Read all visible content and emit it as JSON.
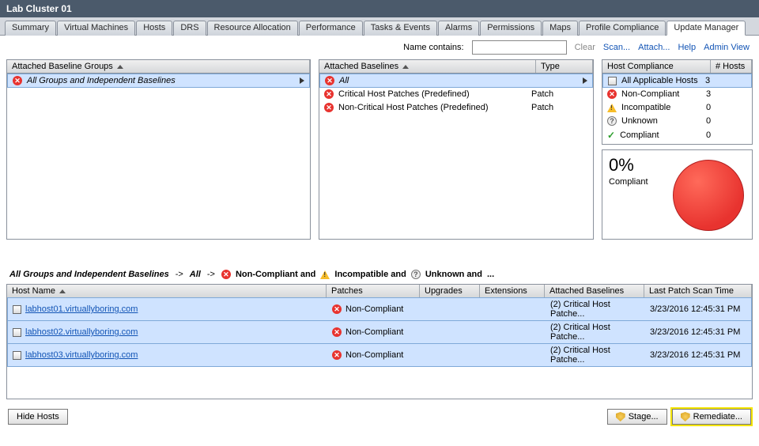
{
  "title": "Lab Cluster 01",
  "tabs": [
    "Summary",
    "Virtual Machines",
    "Hosts",
    "DRS",
    "Resource Allocation",
    "Performance",
    "Tasks & Events",
    "Alarms",
    "Permissions",
    "Maps",
    "Profile Compliance",
    "Update Manager"
  ],
  "active_tab": "Update Manager",
  "toolbar": {
    "name_contains": "Name contains:",
    "clear": "Clear",
    "scan": "Scan...",
    "attach": "Attach...",
    "help": "Help",
    "admin": "Admin View"
  },
  "baseline_groups": {
    "header": "Attached Baseline Groups",
    "row": "All Groups and Independent Baselines"
  },
  "baselines": {
    "header_name": "Attached Baselines",
    "header_type": "Type",
    "rows": [
      {
        "name": "All",
        "type": "",
        "sel": true,
        "icon": "err",
        "italic": true
      },
      {
        "name": "Critical Host Patches (Predefined)",
        "type": "Patch",
        "icon": "err"
      },
      {
        "name": "Non-Critical Host Patches (Predefined)",
        "type": "Patch",
        "icon": "err"
      }
    ]
  },
  "compliance": {
    "header_name": "Host Compliance",
    "header_count": "# Hosts",
    "rows": [
      {
        "icon": "host",
        "label": "All Applicable Hosts",
        "count": 3,
        "sel": true
      },
      {
        "icon": "err",
        "label": "Non-Compliant",
        "count": 3
      },
      {
        "icon": "warn",
        "label": "Incompatible",
        "count": 0
      },
      {
        "icon": "unk",
        "label": "Unknown",
        "count": 0
      },
      {
        "icon": "ok",
        "label": "Compliant",
        "count": 0
      }
    ],
    "percent": "0%",
    "percent_label": "Compliant"
  },
  "filter": {
    "p1": "All Groups and Independent Baselines",
    "a1": "->",
    "p2": "All",
    "a2": "->",
    "nc": "Non-Compliant and",
    "inc": "Incompatible and",
    "unk": "Unknown and",
    "dots": "..."
  },
  "hosts_table": {
    "headers": {
      "host": "Host Name",
      "pat": "Patches",
      "upg": "Upgrades",
      "ext": "Extensions",
      "ab": "Attached Baselines",
      "tm": "Last Patch Scan Time"
    },
    "rows": [
      {
        "host": "labhost01.virtuallyboring.com",
        "pat": "Non-Compliant",
        "upg": "",
        "ext": "",
        "ab": "(2) Critical Host Patche...",
        "tm": "3/23/2016 12:45:31 PM"
      },
      {
        "host": "labhost02.virtuallyboring.com",
        "pat": "Non-Compliant",
        "upg": "",
        "ext": "",
        "ab": "(2) Critical Host Patche...",
        "tm": "3/23/2016 12:45:31 PM"
      },
      {
        "host": "labhost03.virtuallyboring.com",
        "pat": "Non-Compliant",
        "upg": "",
        "ext": "",
        "ab": "(2) Critical Host Patche...",
        "tm": "3/23/2016 12:45:31 PM"
      }
    ]
  },
  "buttons": {
    "hide": "Hide Hosts",
    "stage": "Stage...",
    "remediate": "Remediate..."
  },
  "chart_data": {
    "type": "pie",
    "title": "Host Compliance",
    "series": [
      {
        "name": "Non-Compliant",
        "value": 3
      },
      {
        "name": "Incompatible",
        "value": 0
      },
      {
        "name": "Unknown",
        "value": 0
      },
      {
        "name": "Compliant",
        "value": 0
      }
    ],
    "percent_compliant": 0
  }
}
